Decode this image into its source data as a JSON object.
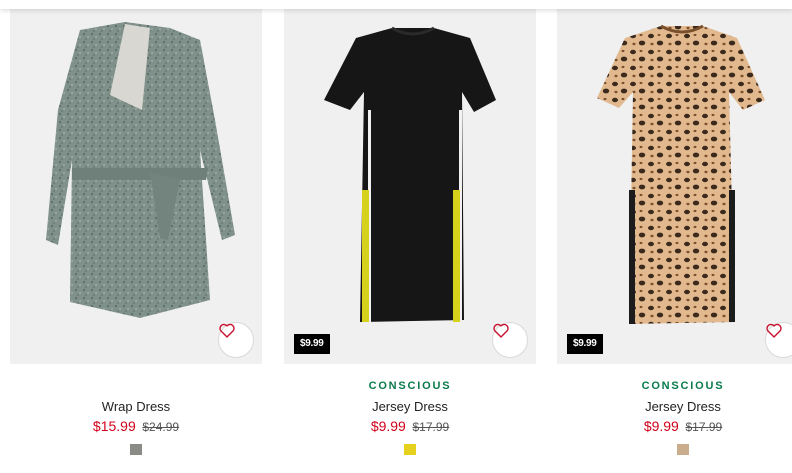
{
  "products": [
    {
      "name": "Wrap Dress",
      "tag": "",
      "price_badge": "",
      "sale_price": "$15.99",
      "original_price": "$24.99",
      "swatch_color": "#8a8b86",
      "image_icon": "wrap-dress-image"
    },
    {
      "name": "Jersey Dress",
      "tag": "CONSCIOUS",
      "price_badge": "$9.99",
      "sale_price": "$9.99",
      "original_price": "$17.99",
      "swatch_color": "#e6d11f",
      "image_icon": "black-jersey-dress-image"
    },
    {
      "name": "Jersey Dress",
      "tag": "CONSCIOUS",
      "price_badge": "$9.99",
      "sale_price": "$9.99",
      "original_price": "$17.99",
      "swatch_color": "#c9ad8d",
      "image_icon": "leopard-jersey-dress-image"
    }
  ],
  "favorite_icon": "heart-outline-icon",
  "colors": {
    "sale_red": "#d0021b",
    "conscious_green": "#097a4a",
    "image_background": "#f0f0f0"
  }
}
